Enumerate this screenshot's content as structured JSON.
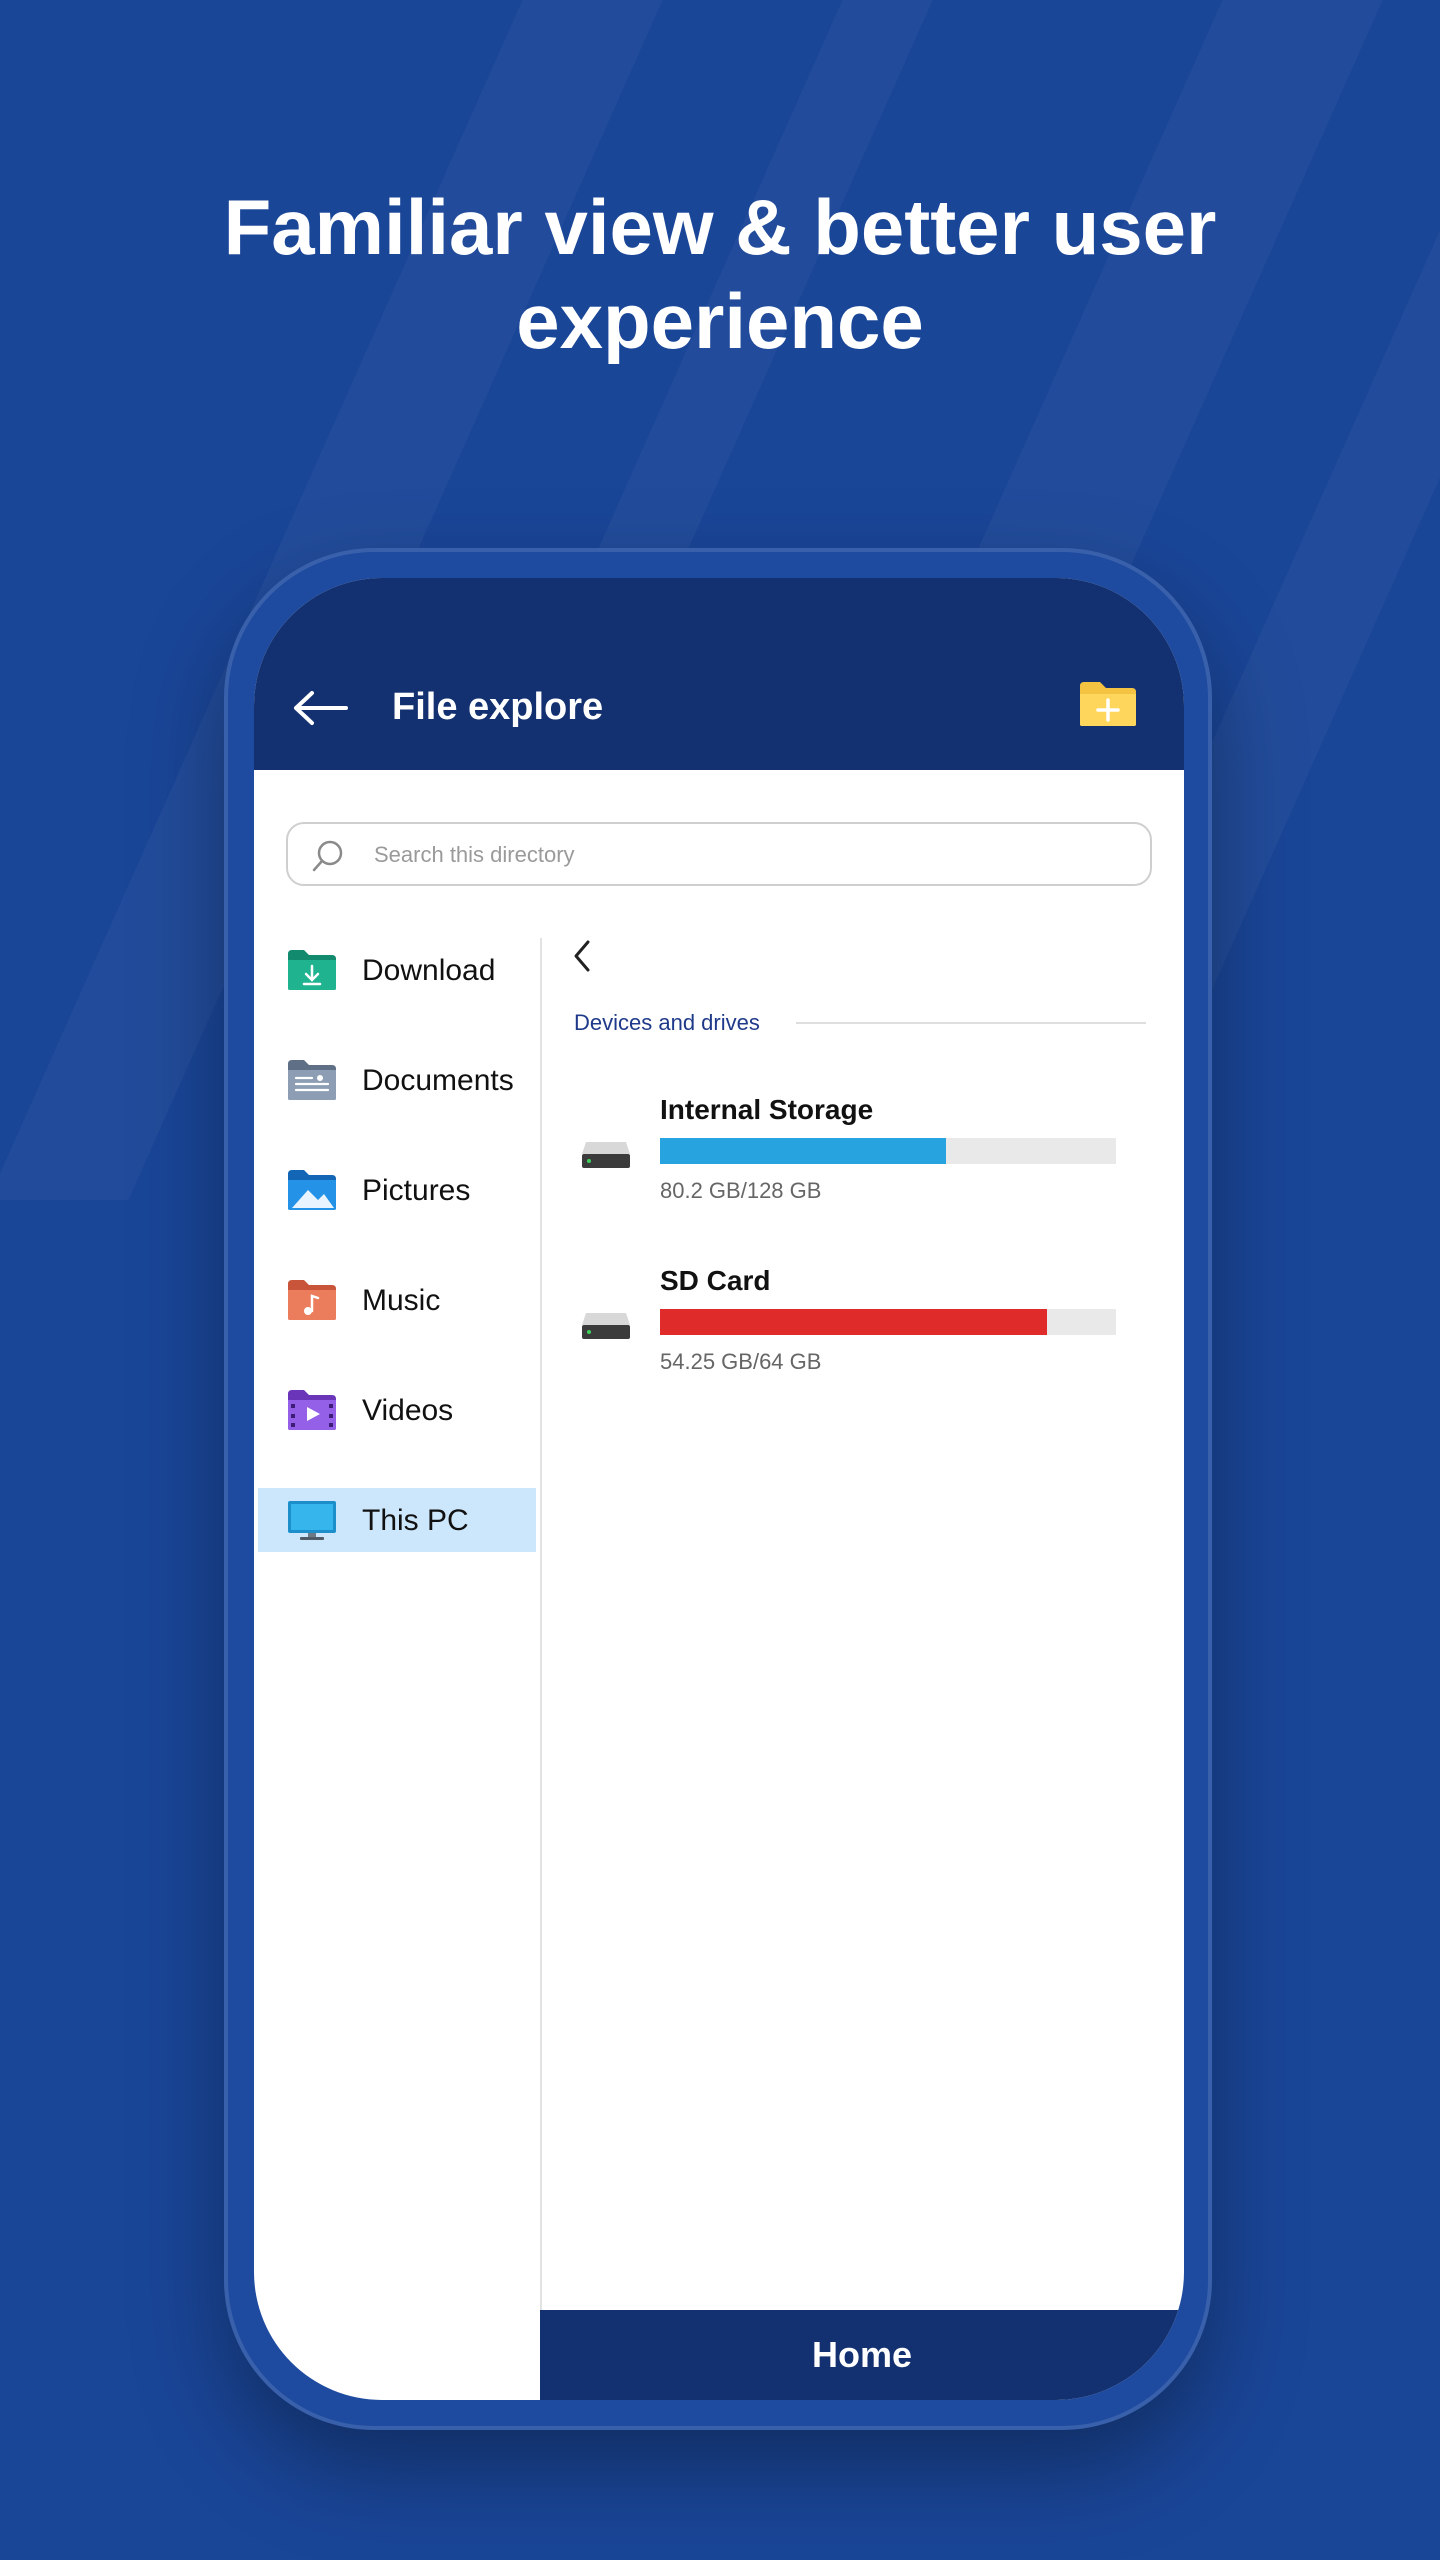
{
  "headline": {
    "line1": "Familiar view & better user",
    "line2": "experience"
  },
  "appbar": {
    "title": "File explore",
    "back_icon": "arrow-left-icon",
    "new_folder_icon": "new-folder-icon"
  },
  "search": {
    "placeholder": "Search this directory"
  },
  "sidebar": {
    "items": [
      {
        "label": "Download",
        "icon": "download-folder-icon",
        "color": "#1fa886"
      },
      {
        "label": "Documents",
        "icon": "documents-folder-icon",
        "color": "#7b8ca4"
      },
      {
        "label": "Pictures",
        "icon": "pictures-folder-icon",
        "color": "#1e88d8"
      },
      {
        "label": "Music",
        "icon": "music-folder-icon",
        "color": "#e46b4a"
      },
      {
        "label": "Videos",
        "icon": "videos-folder-icon",
        "color": "#8750d8"
      },
      {
        "label": "This PC",
        "icon": "monitor-icon",
        "color": "#29a3df",
        "active": true
      }
    ]
  },
  "content": {
    "section_title": "Devices and drives",
    "drives": [
      {
        "name": "Internal Storage",
        "size_text": "80.2 GB/128 GB",
        "used": 80.2,
        "total": 128,
        "color": "#27a4df"
      },
      {
        "name": "SD Card",
        "size_text": "54.25 GB/64 GB",
        "used": 54.25,
        "total": 64,
        "color": "#e02b2b"
      }
    ]
  },
  "bottom": {
    "label": "Home"
  },
  "colors": {
    "background": "#1a4698",
    "appbar": "#133170",
    "active_item": "#cce6fb"
  }
}
